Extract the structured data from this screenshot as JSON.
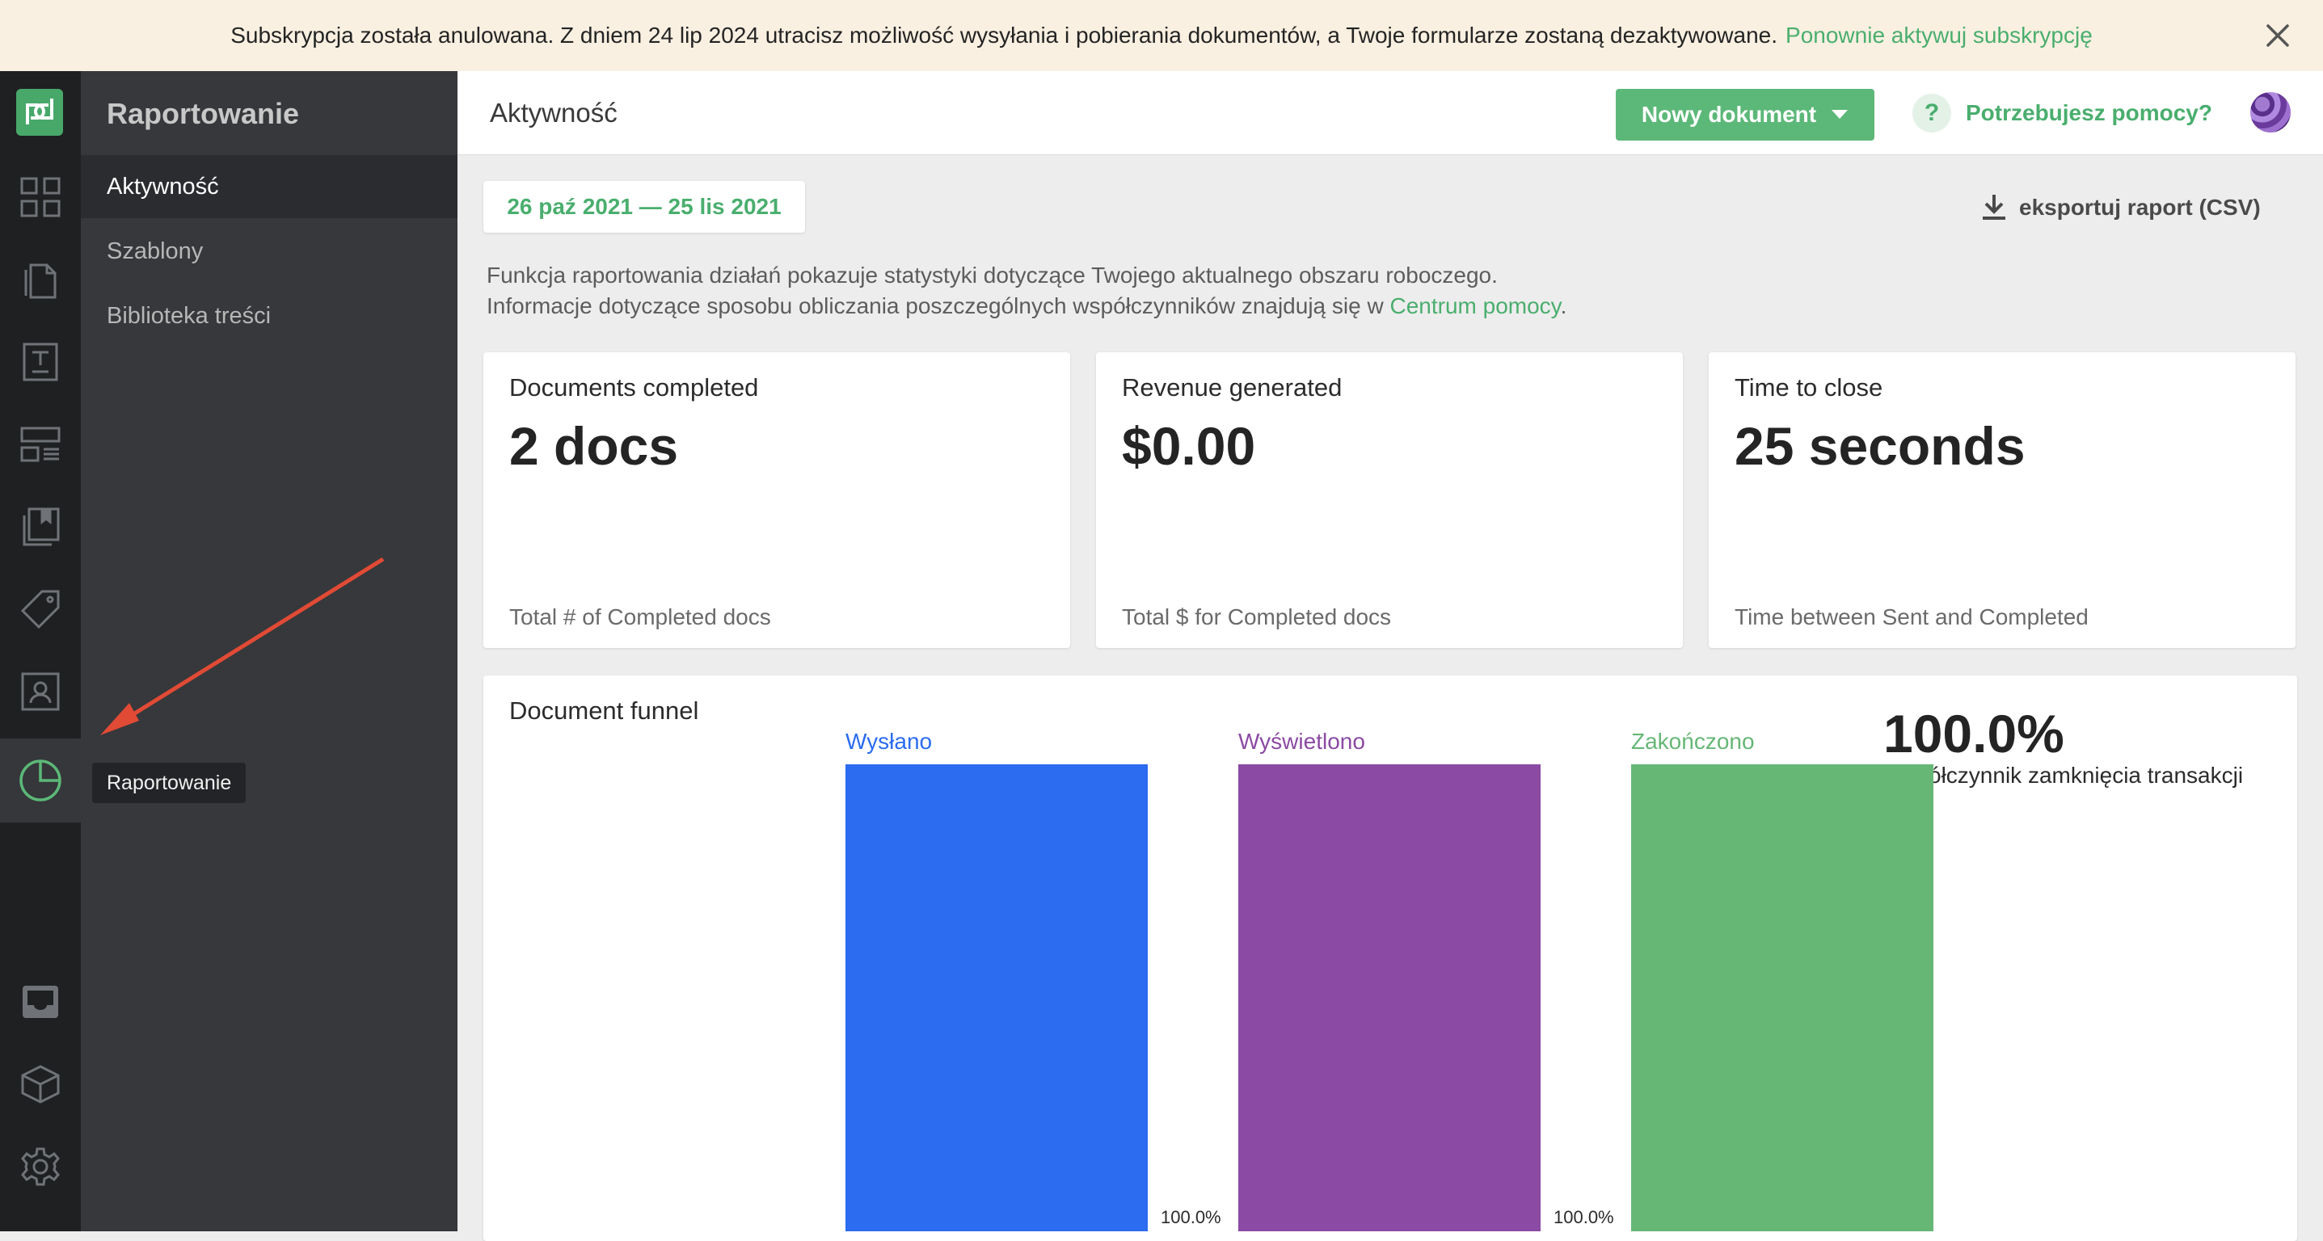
{
  "banner": {
    "message": "Subskrypcja została anulowana. Z dniem 24 lip 2024 utracisz możliwość wysyłania i pobierania dokumentów, a Twoje formularze zostaną dezaktywowane.",
    "link": "Ponownie aktywuj subskrypcję"
  },
  "sidebar": {
    "title": "Raportowanie",
    "items": [
      {
        "label": "Aktywność",
        "active": true
      },
      {
        "label": "Szablony"
      },
      {
        "label": "Biblioteka treści"
      }
    ],
    "tooltip": "Raportowanie"
  },
  "header": {
    "title": "Aktywność",
    "new_document": "Nowy dokument",
    "help": "Potrzebujesz pomocy?"
  },
  "toolbar": {
    "date_range": "26 paź 2021 — 25 lis 2021",
    "export": "eksportuj raport (CSV)"
  },
  "description": {
    "line1": "Funkcja raportowania działań pokazuje statystyki dotyczące Twojego aktualnego obszaru roboczego.",
    "line2": "Informacje dotyczące sposobu obliczania poszczególnych współczynników znajdują się w",
    "link": "Centrum pomocy",
    "suffix": "."
  },
  "cards": [
    {
      "title": "Documents completed",
      "value": "2 docs",
      "footer": "Total # of Completed docs"
    },
    {
      "title": "Revenue generated",
      "value": "$0.00",
      "footer": "Total $ for Completed docs"
    },
    {
      "title": "Time to close",
      "value": "25 seconds",
      "footer": "Time between Sent and Completed"
    }
  ],
  "funnel": {
    "title": "Document funnel",
    "rate": "100.0%",
    "rate_label": "Współczynnik zamknięcia transakcji"
  },
  "chart_data": {
    "type": "bar",
    "categories": [
      "Wysłano",
      "Wyświetlono",
      "Zakończono"
    ],
    "values": [
      100,
      100,
      100
    ],
    "conversion_labels": [
      "100.0%",
      "100.0%"
    ],
    "colors": [
      "#2b6cf0",
      "#8b4aa3",
      "#66b776"
    ]
  }
}
